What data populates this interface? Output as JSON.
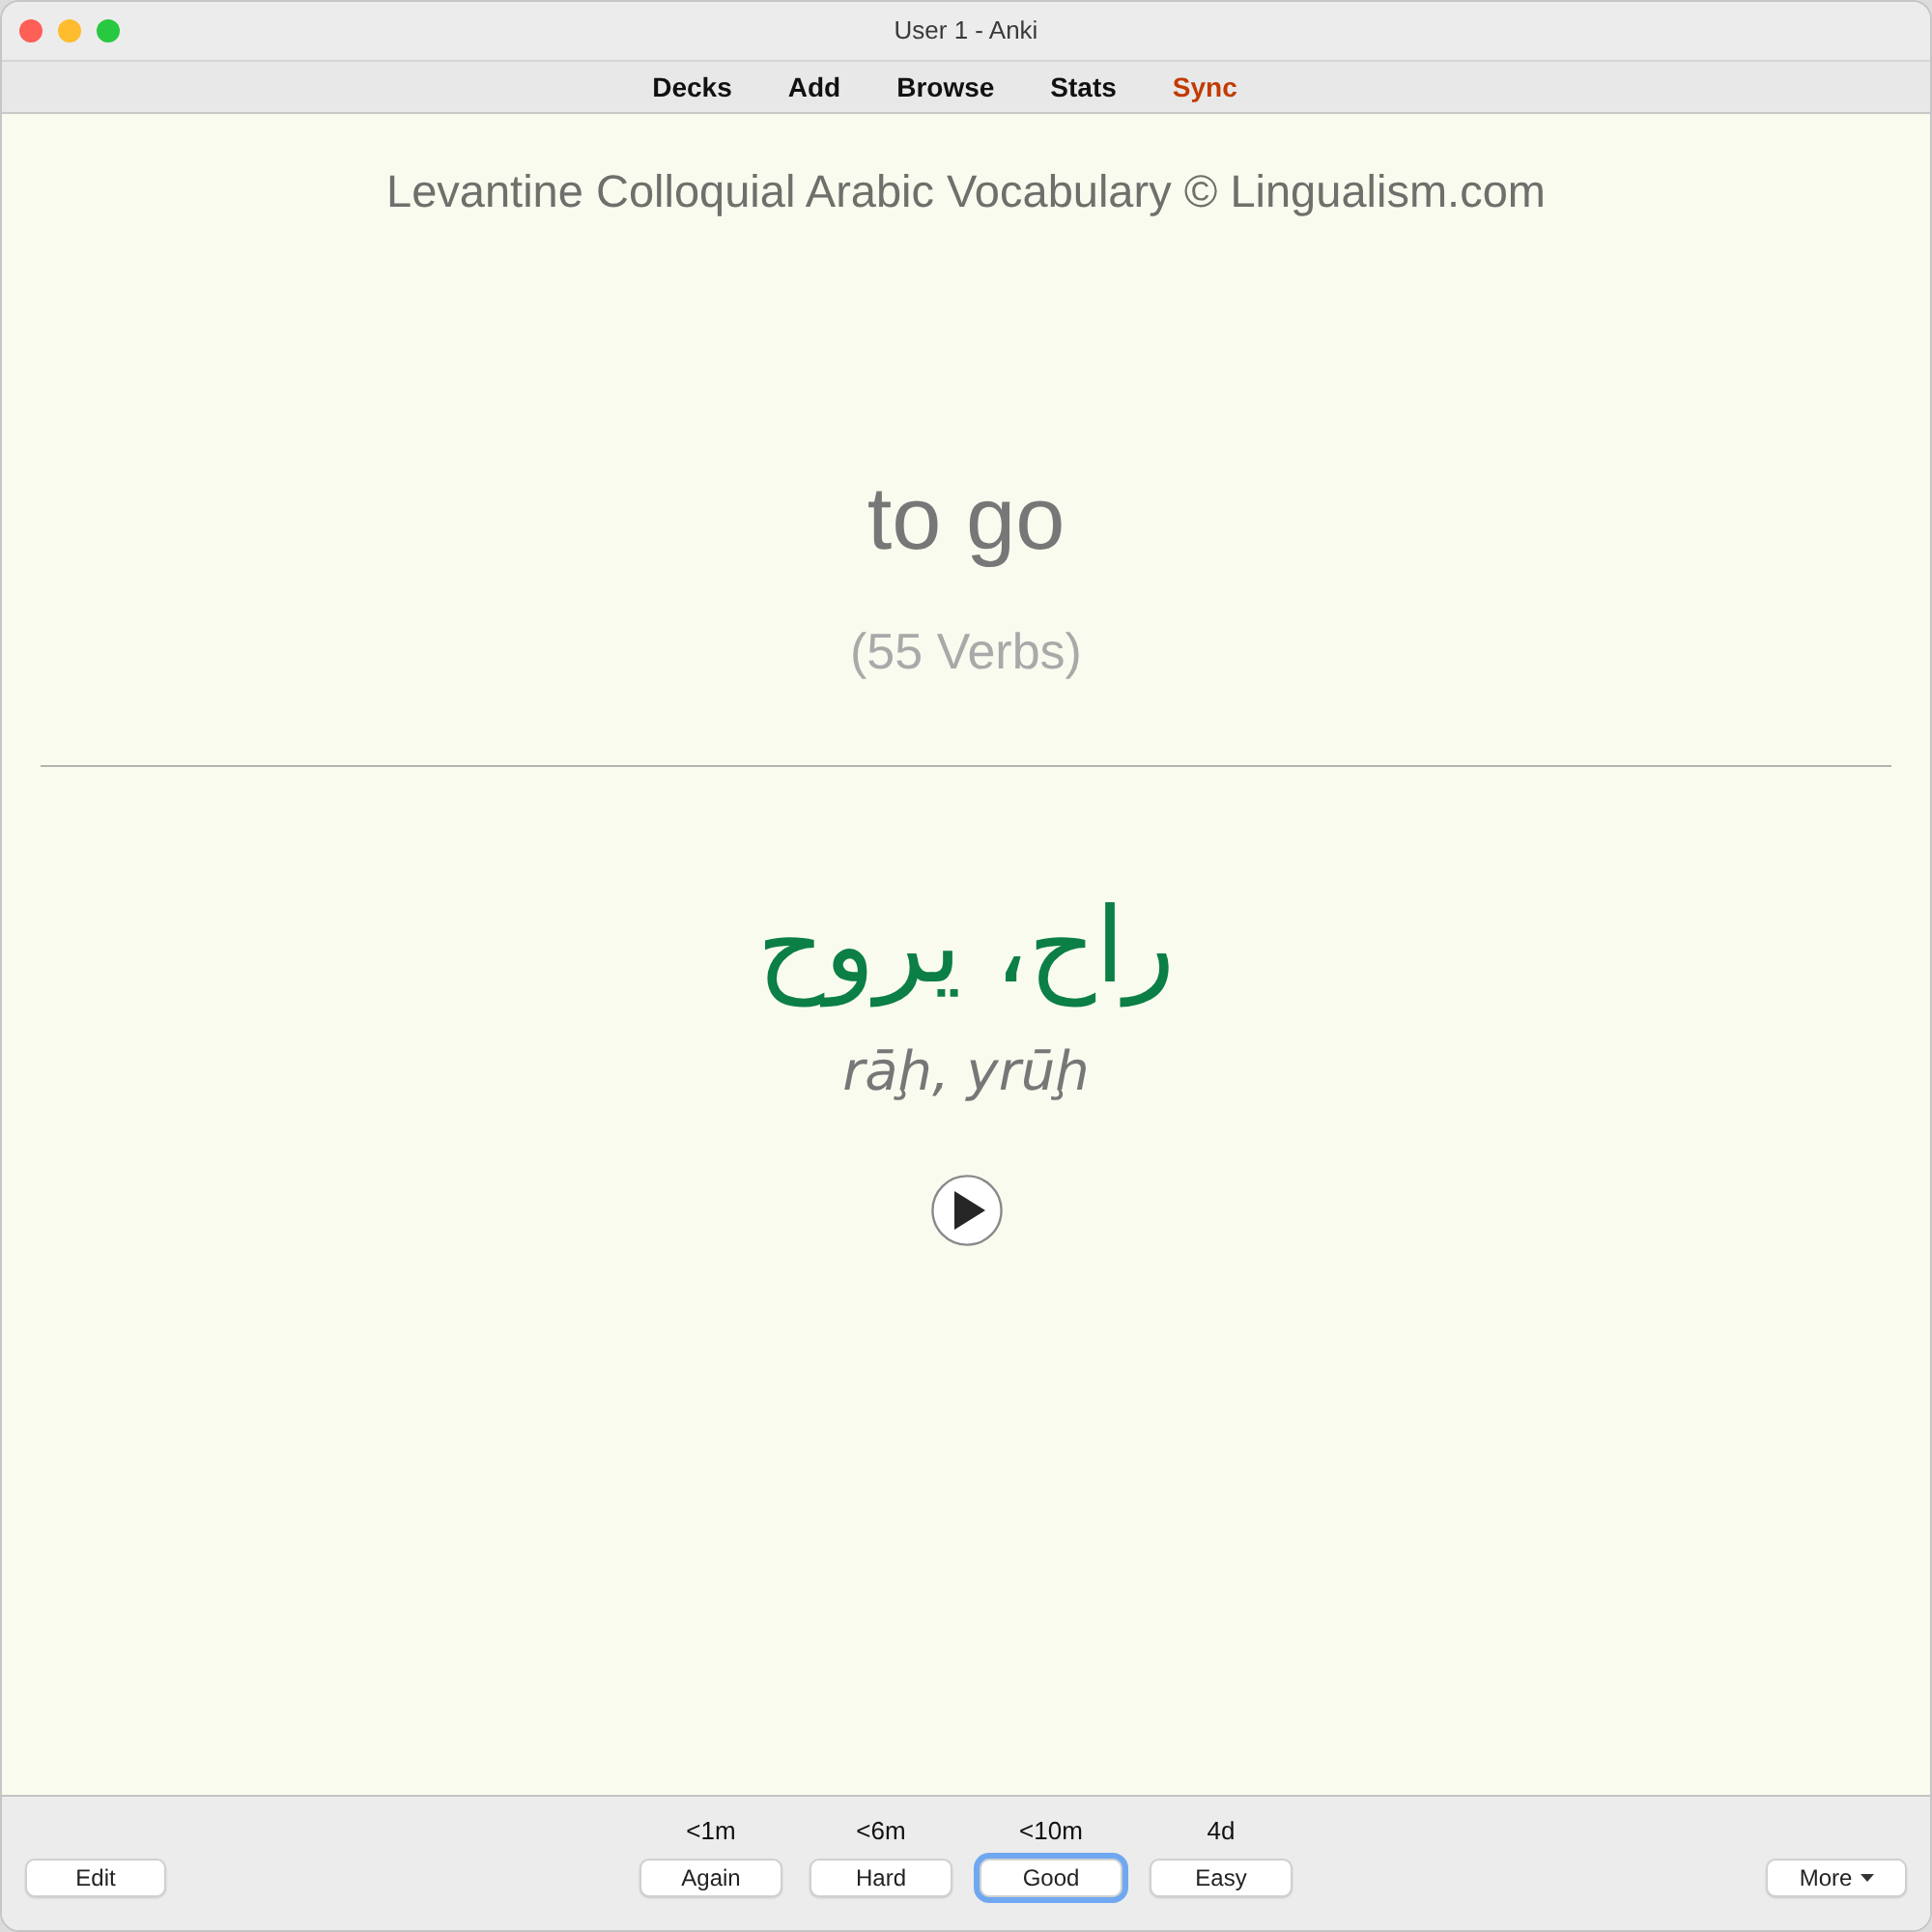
{
  "window": {
    "title": "User 1 - Anki"
  },
  "toolbar": {
    "links": [
      {
        "label": "Decks",
        "highlighted": false
      },
      {
        "label": "Add",
        "highlighted": false
      },
      {
        "label": "Browse",
        "highlighted": false
      },
      {
        "label": "Stats",
        "highlighted": false
      },
      {
        "label": "Sync",
        "highlighted": true
      }
    ]
  },
  "card": {
    "header": "Levantine Colloquial Arabic Vocabulary © Lingualism.com",
    "front": {
      "word": "to go",
      "category": "(55 Verbs)"
    },
    "back": {
      "arabic": "راح، يروح",
      "transliteration": "rāḩ, yrūḩ"
    }
  },
  "bottom_bar": {
    "edit_button": "Edit",
    "answer_buttons": [
      {
        "interval": "<1m",
        "label": "Again",
        "focused": false
      },
      {
        "interval": "<6m",
        "label": "Hard",
        "focused": false
      },
      {
        "interval": "<10m",
        "label": "Good",
        "focused": true
      },
      {
        "interval": "4d",
        "label": "Easy",
        "focused": false
      }
    ],
    "more_button": "More"
  }
}
